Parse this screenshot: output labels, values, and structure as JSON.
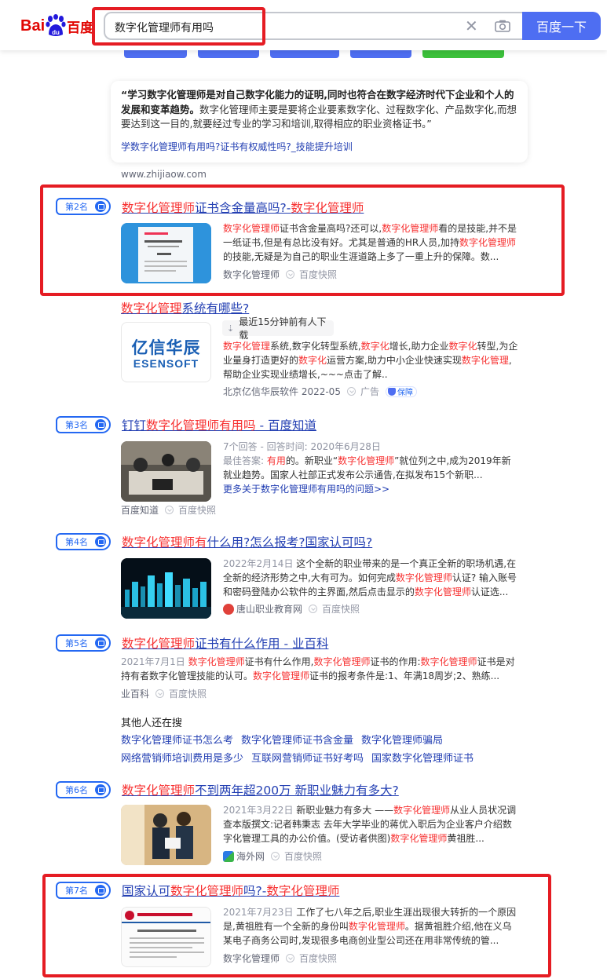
{
  "header": {
    "logo_left": "Bai",
    "logo_right": "百度",
    "search_query": "数字化管理师有用吗",
    "search_button": "百度一下",
    "clear_glyph": "✕"
  },
  "snippet": {
    "quote_bold": "“学习数字化管理师是对自己数字化能力的证明,同时也符合在数字经济时代下企业和个人的发展和变革趋势。",
    "quote_rest": "数字化管理师主要是要将企业要素数字化、过程数字化、产品数字化,而想要达到这一目的,就要经过专业的学习和培训,取得相应的职业资格证书。”",
    "link": "学数字化管理师有用吗?证书有权威性吗?_技能提升培训",
    "site": "www.zhijiaow.com"
  },
  "results": [
    {
      "rank": "第2名",
      "title_hl1": "数字化管理师",
      "title_mid": "证书含金量高吗?-",
      "title_hl2": "数字化管理师",
      "p1": "数字化管理师",
      "p2": "证书含金量高吗?还可以,",
      "p3": "数字化管理师",
      "p4": "看的是技能,并不是一纸证书,但是有总比没有好。尤其是普通的HR人员,加持",
      "p5": "数字化管理师",
      "p6": "的技能,无疑是为自己的职业生涯道路上多了一重上升的保障。数...",
      "source": "数字化管理师",
      "kuaizhao": "百度快照"
    },
    {
      "title_hl": "数字化管理",
      "title_rest": "系统有哪些?",
      "pill": "最近15分钟前有人下载",
      "logo_cn": "亿信华辰",
      "logo_en": "ESENSOFT",
      "para": [
        {
          "t": "数字化管理",
          "h": true
        },
        {
          "t": "系统,数字化转型系统,",
          "h": false
        },
        {
          "t": "数字化",
          "h": true
        },
        {
          "t": "增长,助力企业",
          "h": false
        },
        {
          "t": "数字化",
          "h": true
        },
        {
          "t": "转型,为企业量身打造更好的",
          "h": false
        },
        {
          "t": "数字化",
          "h": true
        },
        {
          "t": "运营方案,助力中小企业快速实现",
          "h": false
        },
        {
          "t": "数字化管理",
          "h": true
        },
        {
          "t": ",帮助企业实现业绩增长,~~~点击了解..",
          "h": false
        }
      ],
      "source": "北京亿信华辰软件 2022-05",
      "ad": "广告",
      "guarantee": "保障"
    },
    {
      "rank": "第3名",
      "title_pre": "钉钉",
      "title_hl": "数字化管理师有用吗",
      "title_rest": " - 百度知道",
      "meta": "7个回答 - 回答时间: 2020年6月28日",
      "best_label": "最佳答案: ",
      "best_hl": "有用",
      "best_rest": "的。新职业“",
      "best_hl2": "数字化管理师",
      "best_rest2": "”就位列之中,成为2019年新就业趋势。国家人社部正式发布公示通告,在拟发布15个新职...",
      "more": "更多关于数字化管理师有用吗的问题>>",
      "source": "百度知道",
      "kuaizhao": "百度快照"
    },
    {
      "rank": "第4名",
      "title_hl": "数字化管理师有",
      "title_rest": "什么用?怎么报考?国家认可吗?",
      "date": "2022年2月14日",
      "p1": " 这个全新的职业带来的是一个真正全新的职场机遇,在全新的经济形势之中,大有可为。如何完成",
      "p2": "数字化管理师",
      "p3": "认证? 输入账号和密码登陆办公软件的主界面,然后点击显示的",
      "p4": "数字化管理师",
      "p5": "认证选...",
      "source": "唐山职业教育网",
      "kuaizhao": "百度快照"
    },
    {
      "rank": "第5名",
      "title_hl": "数字化管理师",
      "title_rest": "证书有什么作用 - 业百科",
      "date": "2021年7月1日",
      "p1": " ",
      "p2": "数字化管理师",
      "p3": "证书有什么作用,",
      "p4": "数字化管理师",
      "p5": "证书的作用:",
      "p6": "数字化管理师",
      "p7": "证书是对持有者数字化管理技能的认可。",
      "p8": "数字化管理师",
      "p9": "证书的报考条件是:1、年满18周岁;2、熟练...",
      "source": "业百科",
      "kuaizhao": "百度快照"
    },
    {
      "rank": "第6名",
      "title_hl": "数字化管理师",
      "title_rest": "不到两年超200万 新职业魅力有多大?",
      "date": "2021年3月22日",
      "p1": " 新职业魅力有多大 ——",
      "p2": "数字化管理师",
      "p3": "从业人员状况调查本版撰文:记者韩秉志 去年大学毕业的蒋优入职后为企业客户介绍数字化管理工具的办公价值。(受访者供图)",
      "p4": "数字化管理师",
      "p5": "黄祖胜...",
      "source": "海外网",
      "kuaizhao": "百度快照"
    },
    {
      "rank": "第7名",
      "title_pre": "国家认可",
      "title_hl1": "数字化管理师",
      "title_mid": "吗?-",
      "title_hl2": "数字化管理师",
      "date": "2021年7月23日",
      "p1": " 工作了七八年之后,职业生涯出现很大转折的一个原因是,黄祖胜有一个全新的身份叫",
      "p2": "数字化管理师",
      "p3": "。据黄祖胜介绍,他在义乌某电子商务公司时,发现很多电商创业型公司还在用非常传统的管...",
      "source": "数字化管理师",
      "kuaizhao": "百度快照"
    }
  ],
  "related": {
    "heading": "其他人还在搜",
    "items": [
      "数字化管理师证书怎么考",
      "数字化管理师证书含金量",
      "数字化管理师骗局",
      "网络营销师培训费用是多少",
      "互联网营销师证书好考吗",
      "国家数字化管理师证书"
    ]
  },
  "colors": {
    "brand_blue": "#4e6ef2",
    "link": "#2440b3",
    "highlight": "#f73131",
    "annotation_red": "#e51c23"
  }
}
